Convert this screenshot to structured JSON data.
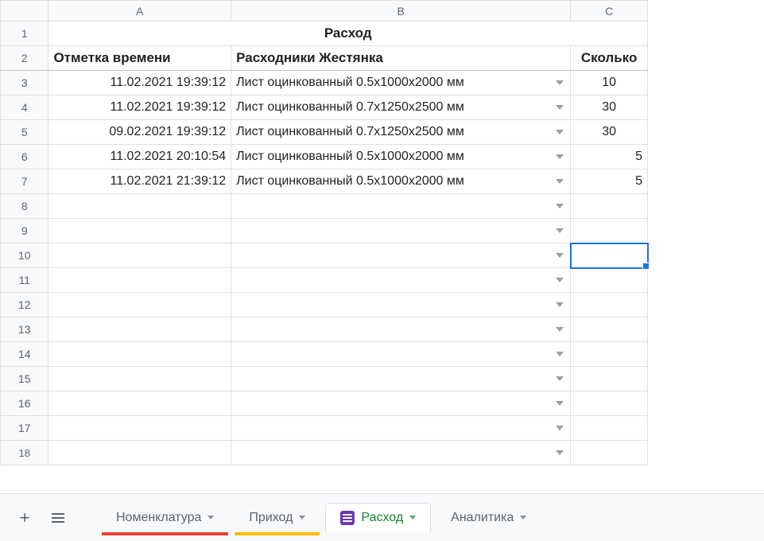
{
  "columns": {
    "A": "A",
    "B": "B",
    "C": "C"
  },
  "rownums": [
    "1",
    "2",
    "3",
    "4",
    "5",
    "6",
    "7",
    "8",
    "9",
    "10",
    "11",
    "12",
    "13",
    "14",
    "15",
    "16",
    "17",
    "18"
  ],
  "title": "Расход",
  "headers": {
    "a": "Отметка времени",
    "b": "Расходники Жестянка",
    "c": "Сколько"
  },
  "rows": [
    {
      "ts": "11.02.2021 19:39:12",
      "item": "Лист оцинкованный 0.5х1000х2000 мм",
      "qty": "10",
      "align": "center"
    },
    {
      "ts": "11.02.2021 19:39:12",
      "item": "Лист оцинкованный 0.7х1250х2500 мм",
      "qty": "30",
      "align": "center"
    },
    {
      "ts": "09.02.2021 19:39:12",
      "item": "Лист оцинкованный 0.7х1250х2500 мм",
      "qty": "30",
      "align": "center"
    },
    {
      "ts": "11.02.2021 20:10:54",
      "item": "Лист оцинкованный 0.5х1000х2000 мм",
      "qty": "5",
      "align": "right"
    },
    {
      "ts": "11.02.2021 21:39:12",
      "item": "Лист оцинкованный 0.5х1000х2000 мм",
      "qty": "5",
      "align": "right"
    }
  ],
  "selected_cell": "C10",
  "tabs": {
    "nomenclature": "Номенклатура",
    "income": "Приход",
    "expense": "Расход",
    "analytics": "Аналитика"
  }
}
